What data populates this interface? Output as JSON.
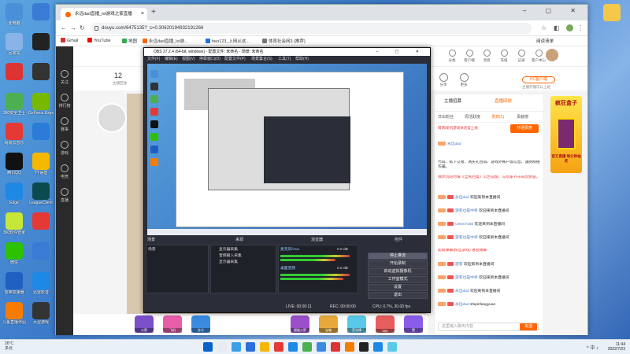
{
  "desktop": {
    "left_icons": [
      {
        "label": "此电脑",
        "color": "#4a90d9"
      },
      {
        "label": "",
        "color": "#3a7bd5"
      },
      {
        "label": "回收站",
        "color": "#8ab4e8"
      },
      {
        "label": "",
        "color": "#222222"
      },
      {
        "label": "",
        "color": "#d33"
      },
      {
        "label": "",
        "color": "#333"
      },
      {
        "label": "360安全卫士",
        "color": "#4caf50"
      },
      {
        "label": "GeForce Experience",
        "color": "#76b900"
      },
      {
        "label": "网易云音乐",
        "color": "#e53935"
      },
      {
        "label": "",
        "color": "#2b7bd8"
      },
      {
        "label": "腾讯QQ",
        "color": "#111"
      },
      {
        "label": "YY语音",
        "color": "#f5b800"
      },
      {
        "label": "Edge",
        "color": "#1e88e5"
      },
      {
        "label": "LeagueClient",
        "color": "#0b4b4f"
      },
      {
        "label": "360软件管家",
        "color": "#c6e63a"
      },
      {
        "label": "",
        "color": "#e53935"
      },
      {
        "label": "微信",
        "color": "#2dc100"
      },
      {
        "label": "",
        "color": "#3a7bd5"
      },
      {
        "label": "雷神加速器",
        "color": "#1f5fbf"
      },
      {
        "label": "迅雷影音",
        "color": "#1e88e5"
      },
      {
        "label": "斗鱼直播伴侣",
        "color": "#f57c00"
      },
      {
        "label": "大型游戏",
        "color": "#333"
      }
    ],
    "right_icon_label": "",
    "right_icon_color": "#f3c84b"
  },
  "browser": {
    "tab_title": "永远dad直播_lol游戏之家直播",
    "new_tab_glyph": "+",
    "window_controls": "– ▢ ✕",
    "url": "douyu.com/6475135?_c=0.30620194932191266",
    "nav": {
      "back": "←",
      "forward": "→",
      "reload": "↻",
      "home": "⌂"
    },
    "bookmarks": [
      {
        "label": "Gmail",
        "color": "#d93025"
      },
      {
        "label": "YouTube",
        "color": "#f00"
      },
      {
        "label": "地图",
        "color": "#34a853"
      },
      {
        "label": "永远dad直播_lol游...",
        "color": "#f60"
      },
      {
        "label": "heo123_上网从这...",
        "color": "#1a73e8"
      },
      {
        "label": "体育社会网3 (推荐)",
        "color": "#777"
      }
    ],
    "reading_list": "阅读清单"
  },
  "douyu": {
    "leftnav": [
      "关注",
      "排行榜",
      "赛事",
      "游戏",
      "电竞",
      "直播"
    ],
    "topbar_icons": [
      "分类",
      "客户端",
      "消息",
      "充值",
      "记录",
      "客户中心"
    ],
    "room_number": "12",
    "room_sub": "主播回放",
    "share_label": "分享",
    "more_label": "更多",
    "pc_btn": "PC客户端",
    "pc_sub": "主播开播可以上班",
    "chat": {
      "tabs": [
        "主播招募",
        "直播回放"
      ],
      "subtabs": [
        "日出粉丝",
        "周活跃度",
        "贵宾(1)",
        "贡献榜"
      ],
      "notice": "萌萌/新机游戏体验官上线",
      "notice_btn": "开通贵族",
      "fans_label": "永远dad",
      "rules": "代码、私下交易、两买礼包码、游戏外帐户等信息，谨防网络诈骗。",
      "rule2": "偶尔玩的时候《全民回复》公告提醒，与玩家齐乐同玩频道。",
      "msgs": [
        {
          "level": "LV 10",
          "name": "永远dad",
          "text": "欢迎来到本直播间"
        },
        {
          "level": "LV 10",
          "name": "游客也是中奖",
          "text": "欢迎来到本直播间"
        },
        {
          "level": "LV 10",
          "name": "Owen7250",
          "text": "欢迎来到本直播间"
        },
        {
          "level": "LV 10",
          "name": "游客也是中奖",
          "text": "欢迎来到本直播间"
        },
        {
          "level": "",
          "name": "",
          "text": "超级弹幕(粉丝游戏) 语音弹幕",
          "system": true
        },
        {
          "level": "LV 10",
          "name": "游客",
          "text": "欢迎来到本直播间"
        },
        {
          "level": "LV 10",
          "name": "游客也是中奖",
          "text": "欢迎来到本直播间"
        },
        {
          "level": "LV 10",
          "name": "永远dad",
          "text": "欢迎来到本直播间"
        },
        {
          "level": "LV 10",
          "name": "永远dad",
          "text": "shipinfangyuan"
        }
      ],
      "input_placeholder": "这里输入聊天内容",
      "send_label": "发送"
    },
    "ad": {
      "title": "疯狂盒子",
      "sub": "官方直播 每分钟抽奖"
    },
    "gifts": [
      {
        "label": "火箭",
        "color": "#7b4fc8"
      },
      {
        "label": "飞机",
        "color": "#e85da8"
      },
      {
        "label": "办卡",
        "color": "#3a8ae0"
      },
      {
        "label": "超级火箭",
        "color": "#9c4fc8"
      },
      {
        "label": "宝箱",
        "color": "#e8a93a"
      },
      {
        "label": "荧光棒",
        "color": "#5ac8e8"
      },
      {
        "label": "666",
        "color": "#e85d5d"
      },
      {
        "label": "赞",
        "color": "#8a5de8"
      }
    ]
  },
  "obs": {
    "title": "OBS 27.2.4 (64-bit, windows) - 配置文件: 未命名 - 场景: 未命名",
    "window_controls": "– ▢ ✕",
    "menu": [
      "文件(F)",
      "编辑(E)",
      "视图(V)",
      "停靠窗口(D)",
      "配置文件(P)",
      "场景集合(S)",
      "工具(T)",
      "帮助(H)"
    ],
    "dock_headers": [
      "场景",
      "来源",
      "混音器",
      "转场",
      "控件"
    ],
    "scene_row": "场景",
    "sources": [
      "显示器采集",
      "音频输入采集",
      "显示器采集"
    ],
    "mixer": [
      {
        "name": "麦克风/Aux",
        "db": "0.0 dB"
      },
      {
        "name": "桌面音频",
        "db": "0.0 dB"
      }
    ],
    "controls": [
      "停止推流",
      "开始录制",
      "启动虚拟摄像机",
      "工作室模式",
      "设置",
      "退出"
    ],
    "status": {
      "live": "LIVE: 00:00:11",
      "rec": "REC: 00:00:00",
      "cpu": "CPU: 0.7%, 30.00 fps"
    }
  },
  "taskbar": {
    "weather_temp": "26°C",
    "weather_desc": "多云",
    "time": "11:44",
    "date": "2022/7/23",
    "tray": "^ 中 ♪",
    "icons": [
      "#0a63c9",
      "#e8ecf2",
      "#3aa0e8",
      "#2a6fdc",
      "#f5b800",
      "#e53935",
      "#1e88e5",
      "#4caf50",
      "#3a8ae0",
      "#d33",
      "#f57c00",
      "#222",
      "#1e88e5",
      "#5ac8e8"
    ]
  }
}
